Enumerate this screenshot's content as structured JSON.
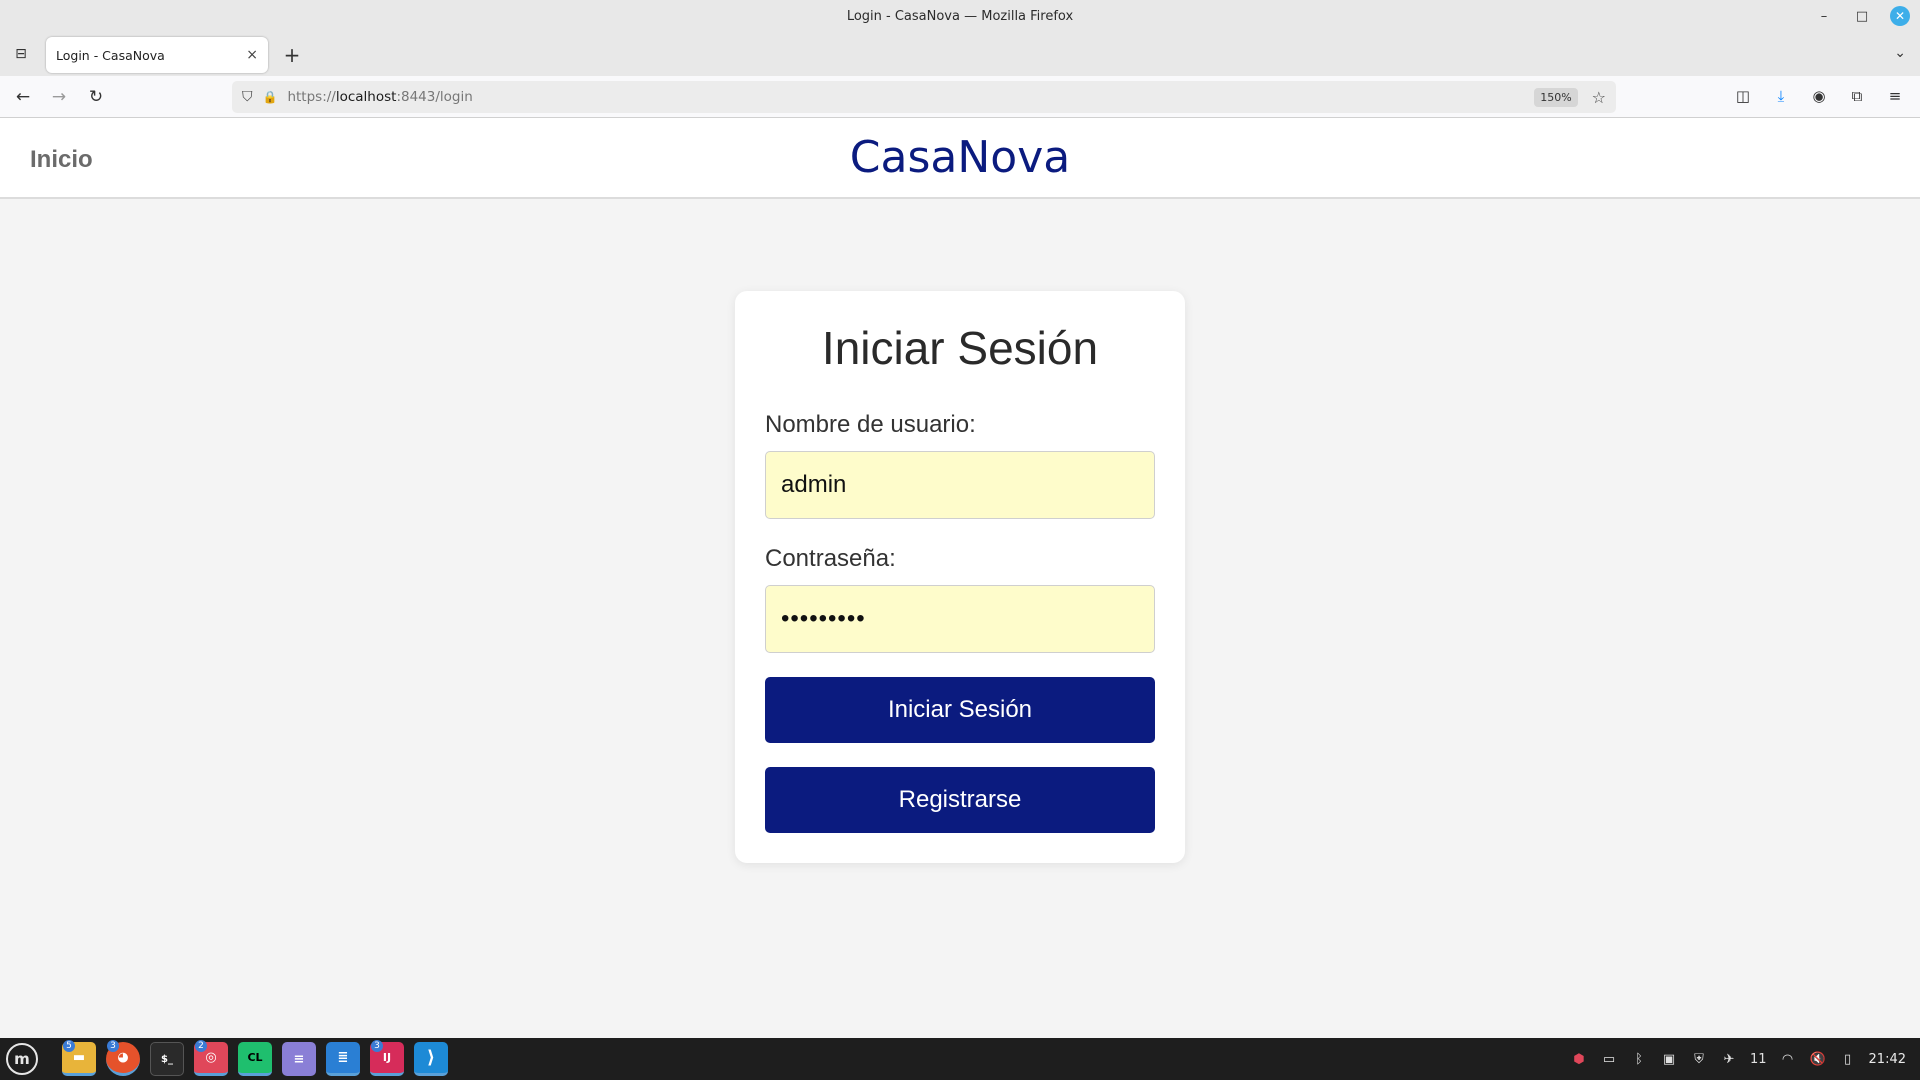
{
  "window": {
    "title": "Login - CasaNova — Mozilla Firefox",
    "minimize": "–",
    "maximize": "□",
    "close": "✕"
  },
  "tabs": {
    "list_icon": "⊟",
    "active_title": "Login - CasaNova",
    "close_icon": "×",
    "new_tab_icon": "+",
    "overflow_icon": "⌄"
  },
  "navbar": {
    "back_icon": "←",
    "forward_icon": "→",
    "reload_icon": "↻",
    "shield_icon": "⛉",
    "lock_icon": "🔒",
    "url_scheme": "https://",
    "url_host": "localhost",
    "url_rest": ":8443/login",
    "zoom": "150%",
    "bookmark_icon": "☆",
    "pocket_icon": "◫",
    "download_icon": "⤓",
    "account_icon": "◉",
    "extensions_icon": "⧉",
    "menu_icon": "≡"
  },
  "site": {
    "home_link": "Inicio",
    "brand": "CasaNova",
    "brand_color": "#0b1b7f"
  },
  "login": {
    "title": "Iniciar Sesión",
    "username_label": "Nombre de usuario:",
    "username_value": "admin",
    "password_label": "Contraseña:",
    "password_value": "•••••••••",
    "submit_label": "Iniciar Sesión",
    "register_label": "Registrarse",
    "input_bg": "#fefccb",
    "button_color": "#0b1b7f"
  },
  "taskbar": {
    "start_icon": "m",
    "apps": [
      {
        "name": "files",
        "badge": "5",
        "glyph": "▬",
        "color": "#e8b43a"
      },
      {
        "name": "firefox",
        "badge": "3",
        "glyph": "◕",
        "color": "#e5522b"
      },
      {
        "name": "terminal",
        "badge": "",
        "glyph": "$_",
        "color": "#2a2a2a"
      },
      {
        "name": "reader",
        "badge": "2",
        "glyph": "◎",
        "color": "#e0475a"
      },
      {
        "name": "clion",
        "badge": "",
        "glyph": "CL",
        "color": "#1fbf6e"
      },
      {
        "name": "notes",
        "badge": "",
        "glyph": "≡",
        "color": "#8a7fd6"
      },
      {
        "name": "writer",
        "badge": "",
        "glyph": "≣",
        "color": "#2a7fd4"
      },
      {
        "name": "intellij",
        "badge": "3",
        "glyph": "IJ",
        "color": "#d62c5a"
      },
      {
        "name": "vscode",
        "badge": "",
        "glyph": "⟩",
        "color": "#1d8ad6"
      }
    ],
    "tray": {
      "volume_level": "11",
      "clock": "21:42"
    }
  }
}
